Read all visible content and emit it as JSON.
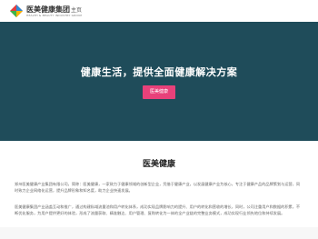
{
  "header": {
    "logo_cn": "医美健康集团",
    "logo_en": "HEALTH & BEAUTY INDUSTRY GROUP",
    "nav_home": "主页"
  },
  "hero": {
    "title": "健康生活，提供全面健康解决方案",
    "button": "医美健康",
    "bg_color": "#1f4c5a",
    "button_color": "#e8417a"
  },
  "about": {
    "title": "医美健康",
    "paragraph1": "郑州医美健康产业集团有限公司，简称：医美健康，一家致力于健康领域的创新型企业，凭借于健康产业，以发展健康产业为核心，专注于健康产品的品牌策划与运营，同时致力企业网络化运营，提升品牌形象和知名度，助力企业快速发展。",
    "paragraph2": "医美健康集团产业涵盖互动和推广，通过构建私域流量池和用户转化体系，成功实现品牌影响力的提升、用户的转化和营收的增长，同时，公司注重用户和数据的积累，不断优化服务，为用户提供更好的体验，形成了流量获取、精准触达、用户管理、复购转化为一体的全产业链的完整业务模式，成功实现行业领先地位和持续发展。"
  }
}
